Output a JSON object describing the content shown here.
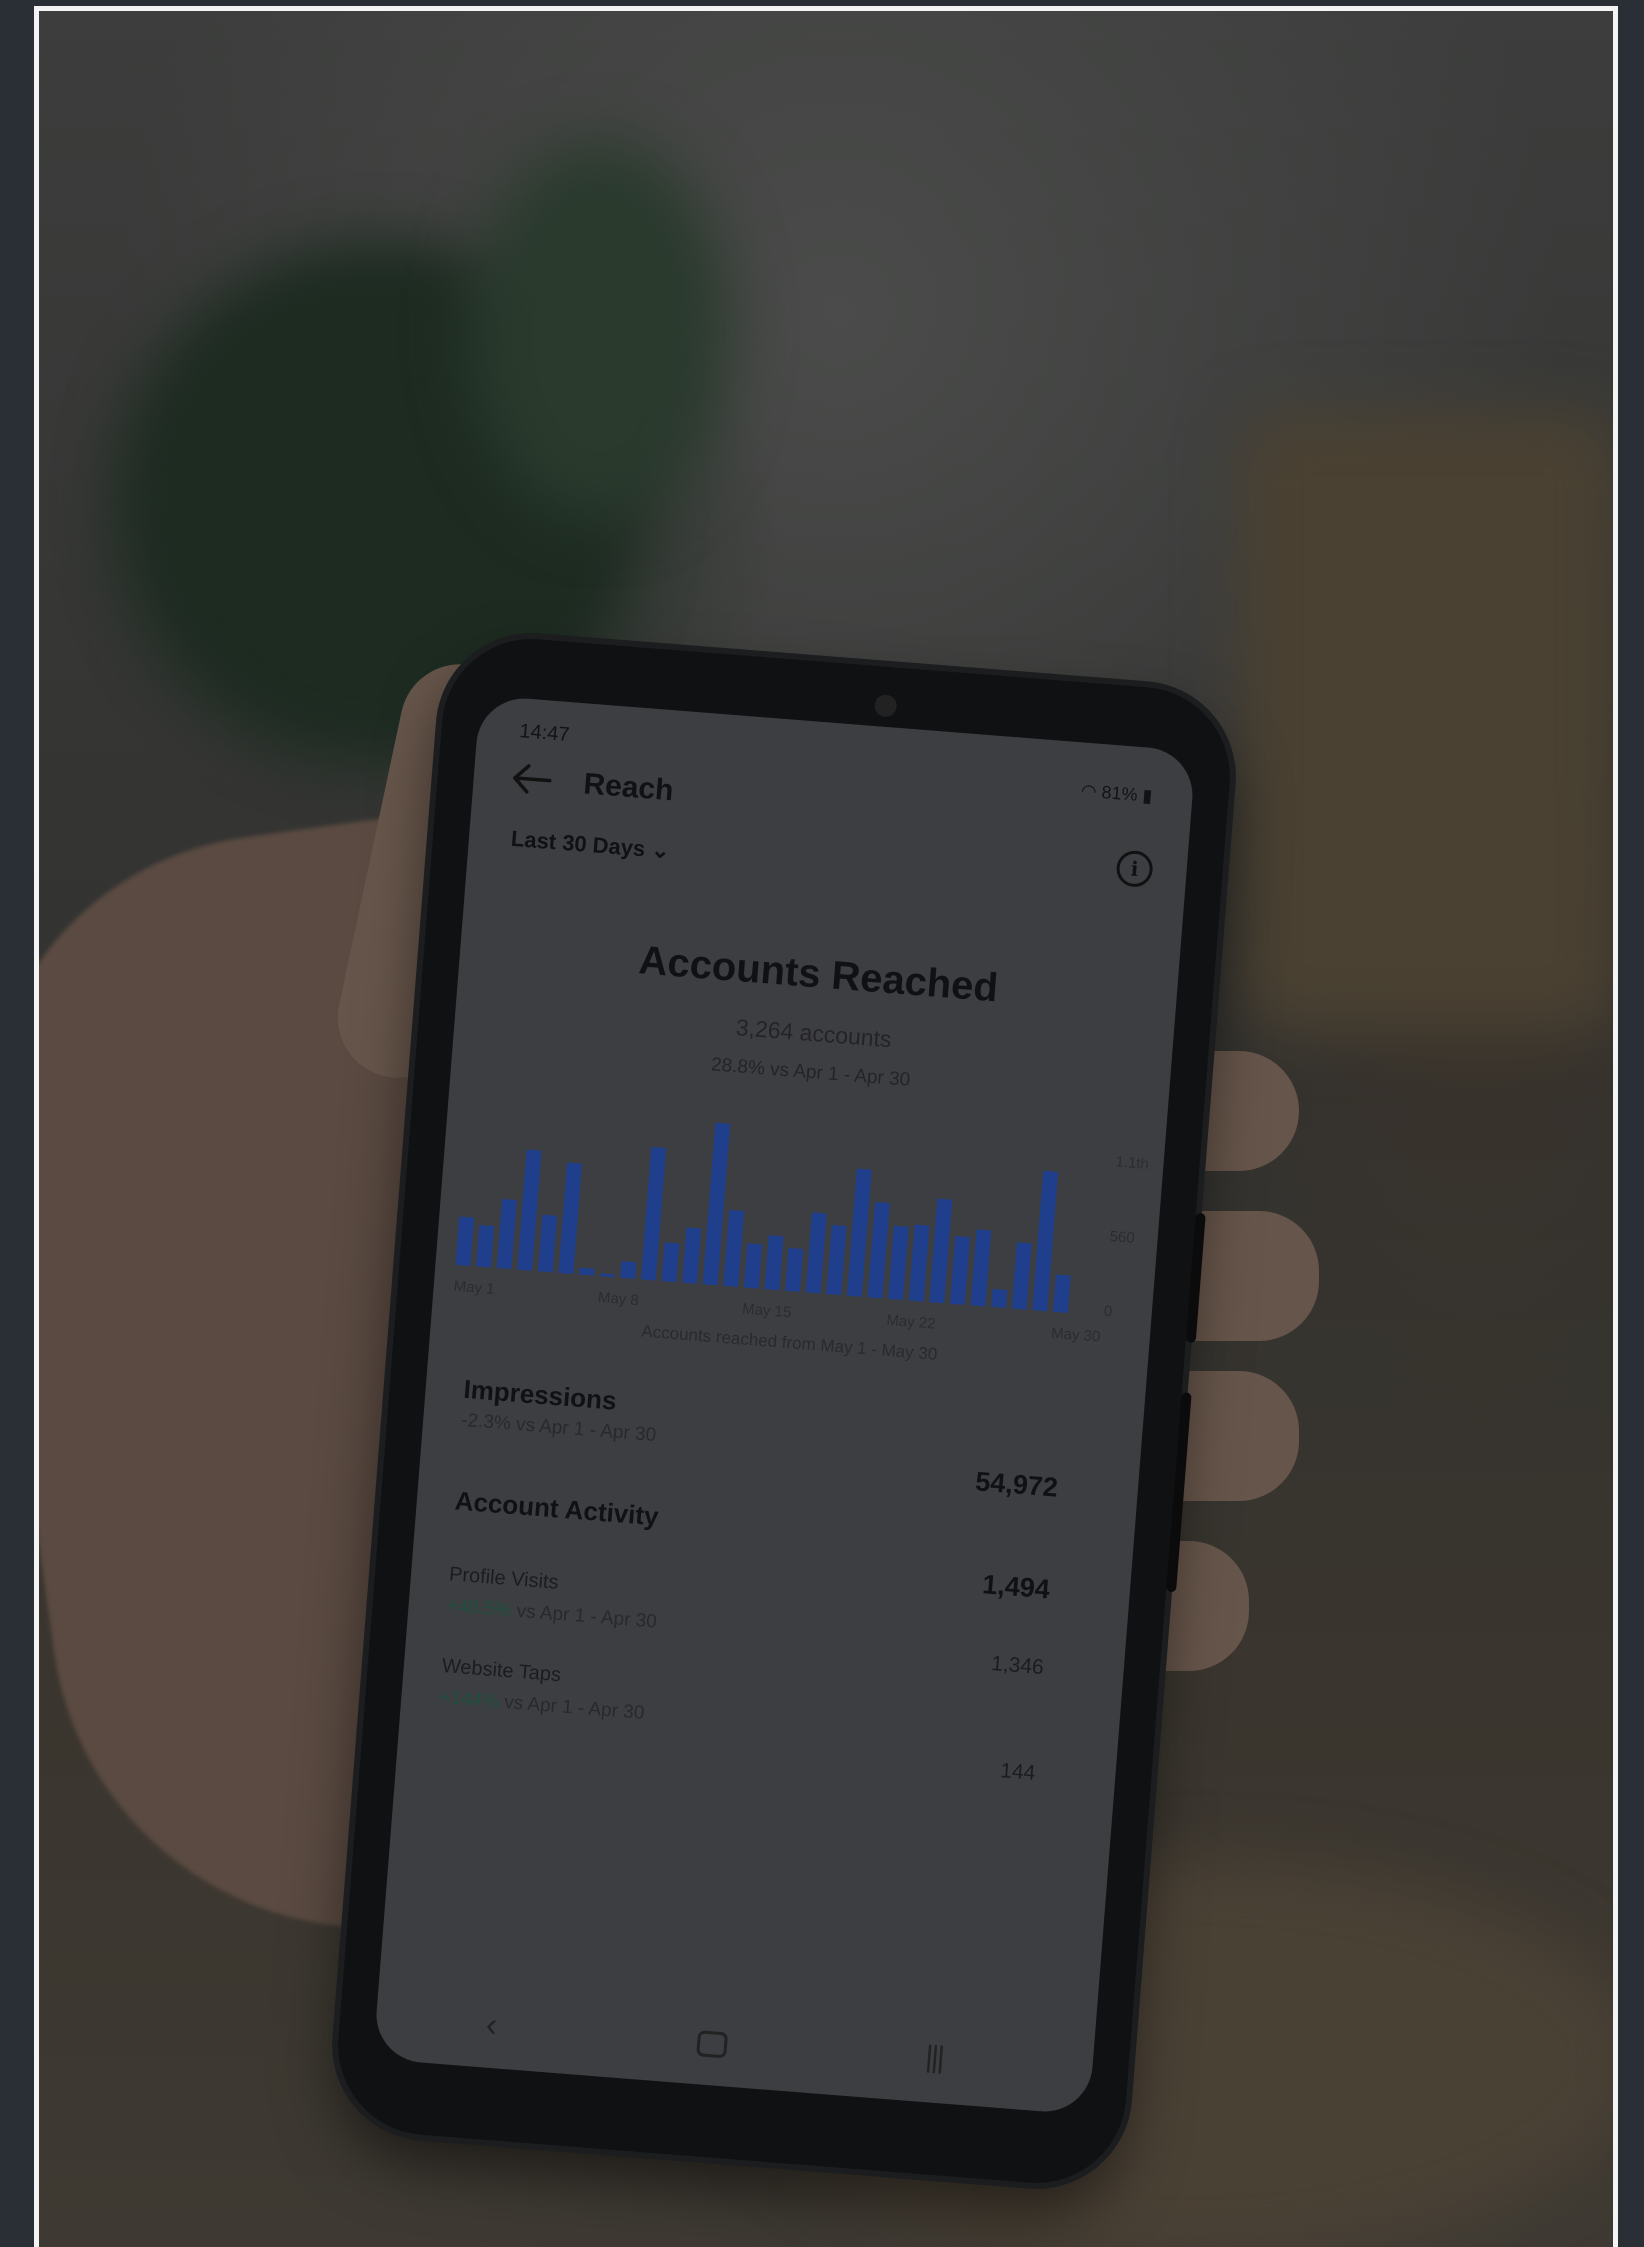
{
  "phone": {
    "status_time": "14:47",
    "status_battery": "81%",
    "page_title": "Reach",
    "date_range": "Last 30 Days",
    "heading": "Accounts Reached",
    "accounts_count": "3,264 accounts",
    "accounts_delta": "28.8% vs Apr 1 - Apr 30",
    "caption": "Accounts reached from May 1 - May 30",
    "impressions": {
      "title": "Impressions",
      "delta": "-2.3% vs Apr 1 - Apr 30",
      "value": "54,972"
    },
    "account_activity": {
      "title": "Account Activity",
      "value": "1,494",
      "profile_visits": {
        "label": "Profile Visits",
        "delta_value": "+48.5%",
        "delta_rest": " vs Apr 1 - Apr 30",
        "value": "1,346"
      },
      "website_taps": {
        "label": "Website Taps",
        "delta_value": "+144%",
        "delta_rest": " vs Apr 1 - Apr 30",
        "value": "144"
      }
    },
    "colors": {
      "bar": "#1f3f8c",
      "positive": "#1f4e3c"
    }
  },
  "chart_data": {
    "type": "bar",
    "categories": [
      "May 1",
      "May 2",
      "May 3",
      "May 4",
      "May 5",
      "May 6",
      "May 7",
      "May 8",
      "May 9",
      "May 10",
      "May 11",
      "May 12",
      "May 13",
      "May 14",
      "May 15",
      "May 16",
      "May 17",
      "May 18",
      "May 19",
      "May 20",
      "May 21",
      "May 22",
      "May 23",
      "May 24",
      "May 25",
      "May 26",
      "May 27",
      "May 28",
      "May 29",
      "May 30"
    ],
    "x_tick_labels": [
      "May 1",
      "May 8",
      "May 15",
      "May 22",
      "May 30"
    ],
    "values": [
      35,
      30,
      50,
      87,
      41,
      80,
      5,
      2,
      12,
      96,
      28,
      40,
      117,
      55,
      32,
      39,
      31,
      58,
      50,
      92,
      69,
      53,
      55,
      75,
      49,
      55,
      13,
      48,
      101,
      27
    ],
    "y_tick_labels": [
      "1.1th",
      "560",
      "0"
    ],
    "ylim": [
      0,
      130
    ]
  }
}
